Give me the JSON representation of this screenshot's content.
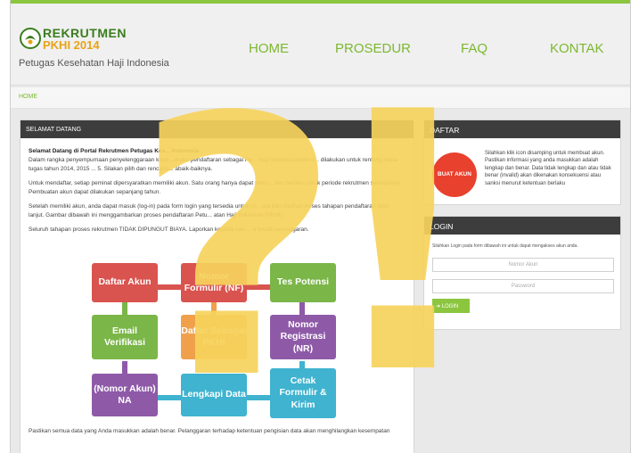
{
  "header": {
    "logo_title": "REKRUTMEN",
    "logo_year": "PKHI 2014",
    "tagline": "Petugas Kesehatan Haji Indonesia"
  },
  "nav": {
    "home": "HOME",
    "prosedur": "PROSEDUR",
    "faq": "FAQ",
    "kontak": "KONTAK"
  },
  "breadcrumb": "HOME",
  "main": {
    "heading": "SELAMAT DATANG",
    "lead": "Selamat Datang di Portal Rekrutmen Petugas Kes... Indonesia",
    "p1": "Dalam rangka penyempurnaan penyelenggaraan kese... maka pendaftaran sebagai Pe... Haji Indonesia telah d... dilakukan untuk rentang masa tugas tahun 2014, 2015 ... 5. Silakan pilih dan rencana... abaik-baiknya.",
    "p2": "Untuk mendaftar, setiap peminat dipersyaratkan memiliki akun. Satu orang hanya dapat mem... dan berlaku untuk periode rekrutmen selanjutnya. Pembuatan akun dapat dilakukan sepanjang tahun.",
    "p3": "Setelah memiliki akun, anda dapat masuk (log-in) pada form login yang tersedia untuk m... ata dan melihat proses tahapan pendaftaran lebih lanjut. Gambar dibawah ini menggambarkan proses pendaftaran Petu... atan Haji Indonesia (PKHI).",
    "p4": "Seluruh tahapan proses rekrutmen TIDAK DIPUNGUT BIAYA. Laporkan kepada kam... a terjadi pelanggaran.",
    "p5": "Pastikan semua data yang Anda masukkan adalah benar. Pelanggaran terhadap ketentuan pengisian data akan menghilangkan kesempatan",
    "flow": {
      "daftar_akun": "Daftar Akun",
      "nomor_formulir": "Nomor Formulir (NF)",
      "tes_potensi": "Tes Potensi",
      "email_verifikasi": "Email Verifikasi",
      "daftar_sebagai": "Daftar Sebagai PKHI",
      "nomor_registrasi": "Nomor Registrasi (NR)",
      "nomor_akun": "(Nomor Akun) NA",
      "lengkapi_data": "Lengkapi Data",
      "cetak_formulir": "Cetak Formulir & Kirim"
    }
  },
  "daftar": {
    "heading": "DAFTAR",
    "button": "BUAT AKUN",
    "text": "Silahkan klik icon disamping untuk membuat akun. Pastikan informasi yang anda masukkan adalah lengkap dan benar. Data tidak lengkap dan atau tidak benar (invalid) akan dikenakan konsekuensi atau sanksi menurut ketentuan berlaku"
  },
  "login": {
    "heading": "LOGIN",
    "hint": "Silahkan Login pada form dibawah ini untuk dapat mengakses akun anda.",
    "account_placeholder": "Nomor Akun",
    "password_placeholder": "Password",
    "button": "LOGIN"
  },
  "overlay": {
    "question": "?",
    "exclaim": "!"
  },
  "colors": {
    "accent_green": "#8cc63f",
    "overlay_yellow": "#f6d35c",
    "box_red": "#d9534f",
    "box_green": "#7ab648",
    "box_orange": "#f0a04b",
    "box_purple": "#8e5aa8",
    "box_teal": "#3fb3cf"
  }
}
